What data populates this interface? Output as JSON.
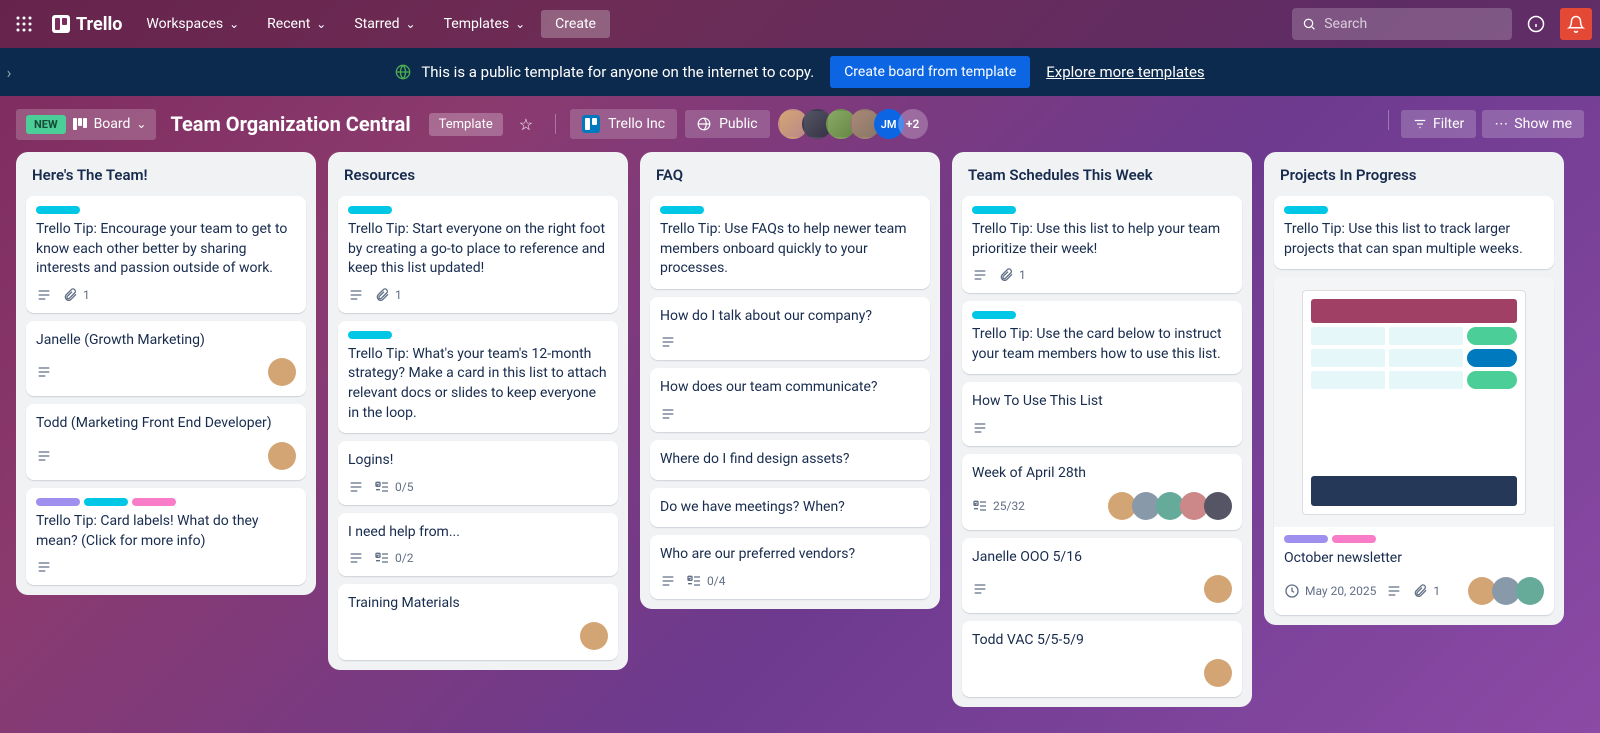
{
  "topbar": {
    "logo": "Trello",
    "nav": [
      "Workspaces",
      "Recent",
      "Starred",
      "Templates"
    ],
    "create": "Create",
    "search_placeholder": "Search"
  },
  "banner": {
    "text": "This is a public template for anyone on the internet to copy.",
    "cta": "Create board from template",
    "link": "Explore more templates"
  },
  "boardbar": {
    "new": "NEW",
    "view": "Board",
    "title": "Team Organization Central",
    "template": "Template",
    "workspace": "Trello Inc",
    "visibility": "Public",
    "more": "+2",
    "filter": "Filter",
    "showmenu": "Show me"
  },
  "lists": [
    {
      "title": "Here's The Team!",
      "cards": [
        {
          "labels": [
            "teal"
          ],
          "text": "Trello Tip: Encourage your team to get to know each other better by sharing interests and passion outside of work.",
          "desc": true,
          "attach": "1"
        },
        {
          "text": "Janelle (Growth Marketing)",
          "desc": true,
          "avatars": 1
        },
        {
          "text": "Todd (Marketing Front End Developer)",
          "desc": true,
          "avatars": 1
        },
        {
          "labels": [
            "purple",
            "teal",
            "pink"
          ],
          "text": "Trello Tip: Card labels! What do they mean? (Click for more info)",
          "desc": true
        }
      ]
    },
    {
      "title": "Resources",
      "cards": [
        {
          "labels": [
            "teal"
          ],
          "text": "Trello Tip: Start everyone on the right foot by creating a go-to place to reference and keep this list updated!",
          "desc": true,
          "attach": "1"
        },
        {
          "labels": [
            "teal"
          ],
          "text": "Trello Tip: What's your team's 12-month strategy? Make a card in this list to attach relevant docs or slides to keep everyone in the loop."
        },
        {
          "text": "Logins!",
          "desc": true,
          "check": "0/5"
        },
        {
          "text": "I need help from...",
          "desc": true,
          "check": "0/2"
        },
        {
          "text": "Training Materials",
          "avatars": 1
        }
      ]
    },
    {
      "title": "FAQ",
      "cards": [
        {
          "labels": [
            "teal"
          ],
          "text": "Trello Tip: Use FAQs to help newer team members onboard quickly to your processes."
        },
        {
          "text": "How do I talk about our company?",
          "desc": true
        },
        {
          "text": "How does our team communicate?",
          "desc": true
        },
        {
          "text": "Where do I find design assets?"
        },
        {
          "text": "Do we have meetings? When?"
        },
        {
          "text": "Who are our preferred vendors?",
          "desc": true,
          "check": "0/4"
        }
      ]
    },
    {
      "title": "Team Schedules This Week",
      "cards": [
        {
          "labels": [
            "teal"
          ],
          "text": "Trello Tip: Use this list to help your team prioritize their week!",
          "desc": true,
          "attach": "1"
        },
        {
          "labels": [
            "teal"
          ],
          "text": "Trello Tip: Use the card below to instruct your team members how to use this list."
        },
        {
          "text": "How To Use This List",
          "desc": true
        },
        {
          "text": "Week of April 28th",
          "check": "25/32",
          "avatars": 5
        },
        {
          "text": "Janelle OOO 5/16",
          "desc": true,
          "avatars": 1
        },
        {
          "text": "Todd VAC 5/5-5/9",
          "avatars": 1
        }
      ]
    },
    {
      "title": "Projects In Progress",
      "cards": [
        {
          "labels": [
            "teal"
          ],
          "text": "Trello Tip: Use this list to track larger projects that can span multiple weeks."
        },
        {
          "cover": true,
          "labels": [
            "purple",
            "pink"
          ],
          "text": "October newsletter",
          "date": "May 20, 2025",
          "desc": true,
          "attach": "1",
          "avatars": 3
        }
      ]
    }
  ]
}
